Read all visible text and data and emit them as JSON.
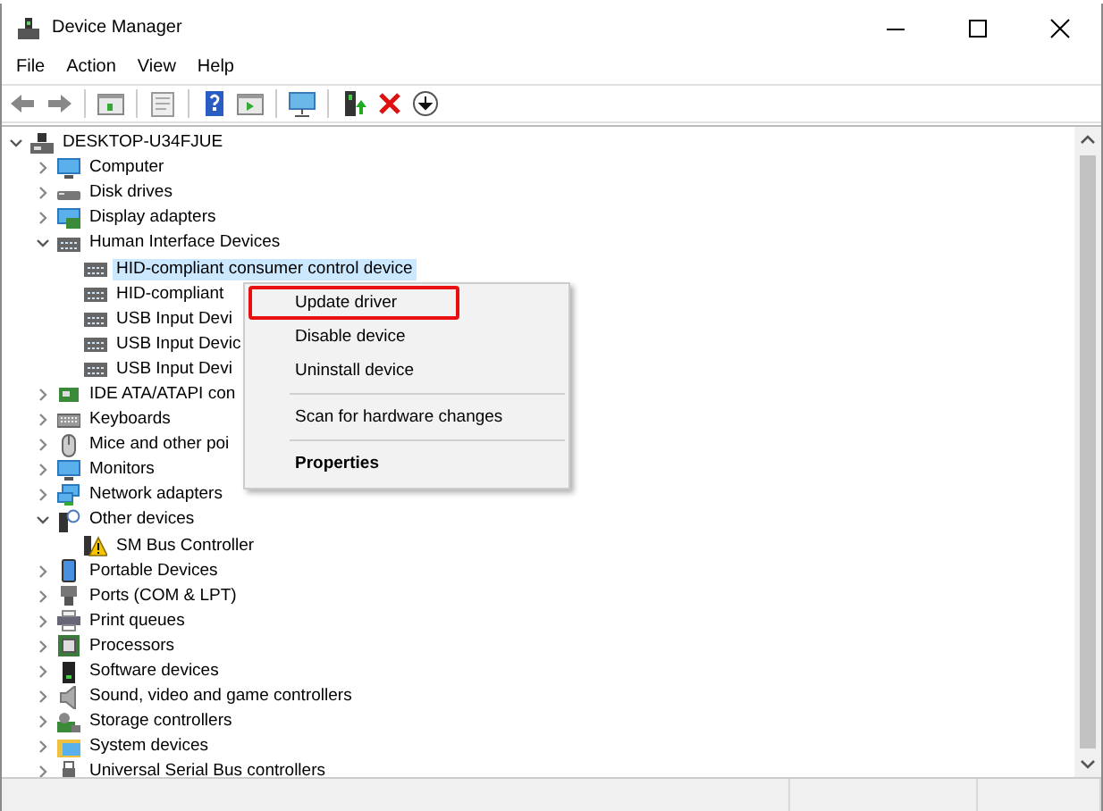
{
  "window": {
    "title": "Device Manager"
  },
  "menu_bar": [
    "File",
    "Action",
    "View",
    "Help"
  ],
  "tree": {
    "label": "DESKTOP-U34FJUE",
    "expanded": true,
    "children": [
      {
        "label": "Computer",
        "expanded": false
      },
      {
        "label": "Disk drives",
        "expanded": false
      },
      {
        "label": "Display adapters",
        "expanded": false
      },
      {
        "label": "Human Interface Devices",
        "expanded": true,
        "children": [
          {
            "label": "HID-compliant consumer control device",
            "selected": true
          },
          {
            "label": "HID-compliant",
            "selected": false
          },
          {
            "label": "USB Input Devi",
            "selected": false
          },
          {
            "label": "USB Input Devic",
            "selected": false
          },
          {
            "label": "USB Input Devi",
            "selected": false
          }
        ]
      },
      {
        "label": "IDE ATA/ATAPI con",
        "expanded": false
      },
      {
        "label": "Keyboards",
        "expanded": false
      },
      {
        "label": "Mice and other poi",
        "expanded": false
      },
      {
        "label": "Monitors",
        "expanded": false
      },
      {
        "label": "Network adapters",
        "expanded": false
      },
      {
        "label": "Other devices",
        "expanded": true,
        "children": [
          {
            "label": "SM Bus Controller",
            "selected": false
          }
        ]
      },
      {
        "label": "Portable Devices",
        "expanded": false
      },
      {
        "label": "Ports (COM & LPT)",
        "expanded": false
      },
      {
        "label": "Print queues",
        "expanded": false
      },
      {
        "label": "Processors",
        "expanded": false
      },
      {
        "label": "Software devices",
        "expanded": false
      },
      {
        "label": "Sound, video and game controllers",
        "expanded": false
      },
      {
        "label": "Storage controllers",
        "expanded": false
      },
      {
        "label": "System devices",
        "expanded": false
      },
      {
        "label": "Universal Serial Bus controllers",
        "expanded": false
      }
    ]
  },
  "context_menu": [
    {
      "kind": "item",
      "label": "Update driver",
      "highlighted": true
    },
    {
      "kind": "item",
      "label": "Disable device",
      "highlighted": false
    },
    {
      "kind": "item",
      "label": "Uninstall device",
      "highlighted": false
    },
    {
      "kind": "separator"
    },
    {
      "kind": "item",
      "label": "Scan for hardware changes",
      "highlighted": false
    },
    {
      "kind": "separator"
    },
    {
      "kind": "item",
      "label": "Properties",
      "highlighted": false,
      "bold": true
    }
  ]
}
